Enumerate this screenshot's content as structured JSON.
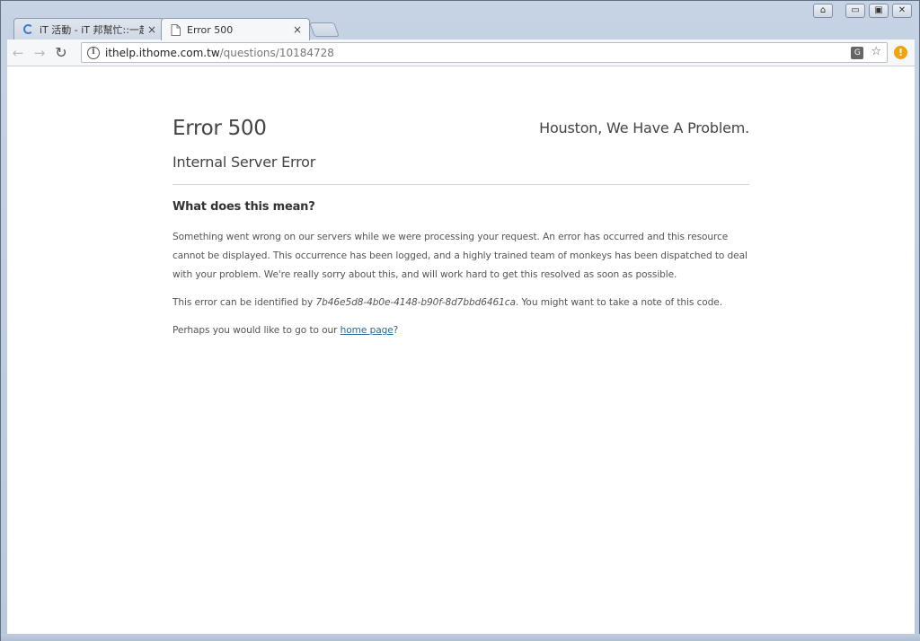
{
  "browser": {
    "tabs": [
      {
        "label": "iT 活動 - iT 邦幫忙::一起幫",
        "state": "loading",
        "close": "×"
      },
      {
        "label": "Error 500",
        "state": "active",
        "close": "×"
      }
    ],
    "window_controls": {
      "user": "⌂",
      "minimize": "▭",
      "restore": "▣",
      "close": "✕"
    },
    "nav": {
      "back": "←",
      "forward": "→",
      "reload": "↻"
    },
    "address": {
      "host": "ithelp.ithome.com.tw",
      "path": "/questions/10184728"
    },
    "omnibox_icons": {
      "translate": "G",
      "bookmark": "☆"
    },
    "alert_badge": "!"
  },
  "page": {
    "title": "Error 500",
    "tagline": "Houston, We Have A Problem.",
    "subtitle": "Internal Server Error",
    "section_heading": "What does this mean?",
    "paragraph1": "Something went wrong on our servers while we were processing your request. An error has occurred and this resource cannot be displayed. This occurrence has been logged, and a highly trained team of monkeys has been dispatched to deal with your problem. We're really sorry about this, and will work hard to get this resolved as soon as possible.",
    "paragraph2_prefix": "This error can be identified by ",
    "error_code": "7b46e5d8-4b0e-4148-b90f-8d7bbd6461ca",
    "paragraph2_suffix": ". You might want to take a note of this code.",
    "paragraph3_prefix": "Perhaps you would like to go to our ",
    "home_link": "home page",
    "paragraph3_suffix": "?"
  },
  "colors": {
    "link": "#2a6b9a",
    "alert": "#f0a30a",
    "spinner": "#3a7bd5"
  }
}
